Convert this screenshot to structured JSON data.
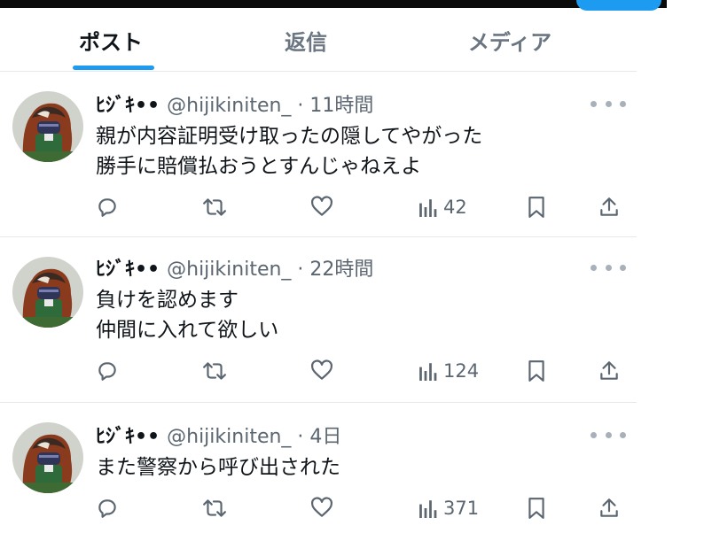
{
  "tabs": [
    {
      "label": "ポスト",
      "active": true
    },
    {
      "label": "返信",
      "active": false
    },
    {
      "label": "メディア",
      "active": false
    }
  ],
  "colors": {
    "accent": "#1d9bf0",
    "text": "#0f1419",
    "muted": "#5b6670",
    "divider": "#e6e9ec"
  },
  "tweets": [
    {
      "name": "ﾋｼﾞｷ••",
      "handle": "@hijikiniten_ · 11時間",
      "lines": [
        "親が内容証明受け取ったの隠してやがった",
        "勝手に賠償払おうとすんじゃねえよ"
      ],
      "views": "42"
    },
    {
      "name": "ﾋｼﾞｷ••",
      "handle": "@hijikiniten_ · 22時間",
      "lines": [
        "負けを認めます",
        "仲間に入れて欲しい"
      ],
      "views": "124"
    },
    {
      "name": "ﾋｼﾞｷ••",
      "handle": "@hijikiniten_ · 4日",
      "lines": [
        "また警察から呼び出された"
      ],
      "views": "371"
    }
  ]
}
